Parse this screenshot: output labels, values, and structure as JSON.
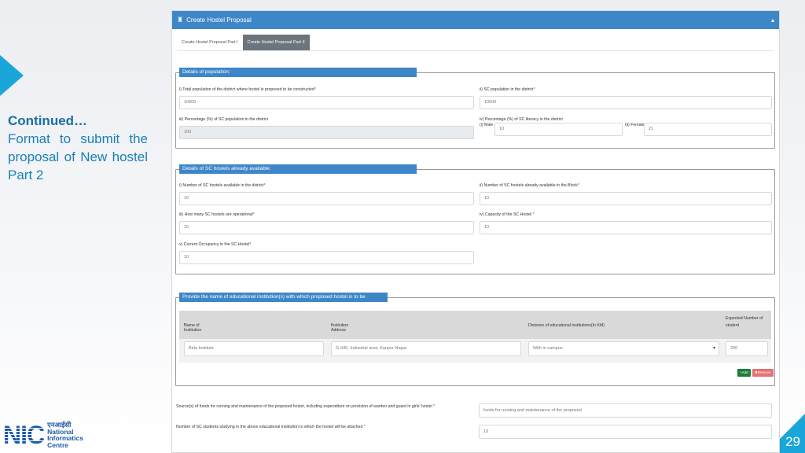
{
  "slide": {
    "caption_head": "Continued…",
    "caption_body": "Format to submit the proposal of New hostel Part 2",
    "page_number": "29",
    "logo": {
      "short": "NIC",
      "hindi": "एनआईसी",
      "line1": "National",
      "line2": "Informatics",
      "line3": "Centre"
    }
  },
  "panel": {
    "title": "Create Hostel Proposal",
    "title_icon": "building-icon",
    "collapse_icon": "▴",
    "tabs": [
      {
        "label": "Create Hostel Proposal Part I",
        "active": false
      },
      {
        "label": "Create Hostel Proposal Part II",
        "active": true
      }
    ]
  },
  "population": {
    "title": "Details of population:",
    "f1": {
      "label": "i) Total population of the district where hostel is proposed to be constructed",
      "value": "10000"
    },
    "f2": {
      "label": "ii) SC population in the district",
      "value": "10000"
    },
    "f3": {
      "label": "iii) Percentage (%) of SC population in the district",
      "value": "100"
    },
    "f4": {
      "label": "iv) Percentage (%) of SC literacy in the district",
      "male_label": "(i) Male",
      "male_value": "10",
      "female_label": "(ii) Female",
      "female_value": "21"
    }
  },
  "hostels": {
    "title": "Details of SC hostels already available:",
    "f1": {
      "label": "i) Number of SC hostels available in the district",
      "value": "10"
    },
    "f2": {
      "label": "ii) Number of SC hostels already available in the Block",
      "value": "10"
    },
    "f3": {
      "label": "iii) How many SC hostels are operational",
      "value": "10"
    },
    "f4": {
      "label": "iv) Capacity of the SC Hostel ",
      "value": "10"
    },
    "f5": {
      "label": "v) Current Occupancy in the SC Hostel",
      "value": "10"
    }
  },
  "institutions": {
    "title": "Provide the name of educational institution(s) with which proposed hostel is to be attached",
    "columns": [
      "Name of Institution ",
      "Institution Address",
      "Distance of educational institutions(In KM)",
      "Expected Number of student"
    ],
    "row": {
      "name": "Birla Institute",
      "address": "G-345, Industrial area, Kanpur Nagar",
      "distance": "With in campus",
      "students": "200"
    },
    "add_label": "+Add",
    "remove_label": "✖Remove"
  },
  "bottom": {
    "funds_label": "Source(s) of funds for running and maintenance of the proposed hostel, including expenditure on provision of warden and guard in girls' hostel ",
    "funds_value": "funds for running and maintenance of the proposed",
    "students_label": "Number of SC students studying in the above educational institution to which the hostel will be attached ",
    "students_value": "10"
  },
  "required_mark": "*"
}
